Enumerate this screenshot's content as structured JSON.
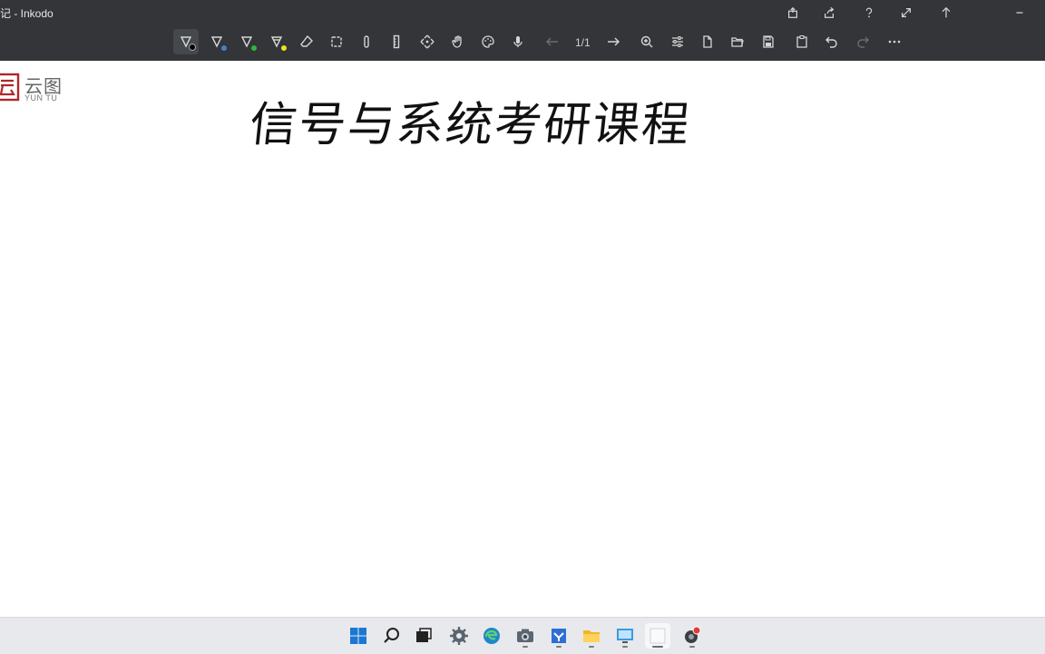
{
  "window": {
    "title": "记 - Inkodo"
  },
  "toolbar": {
    "page_indicator": "1/1",
    "pen_colors": [
      "#000000",
      "#4a7bd6",
      "#2db83d",
      "#e6e61c"
    ]
  },
  "canvas": {
    "logo_cn": "云图",
    "logo_en": "YUN TU",
    "handwritten_title": "信号与系统考研课程"
  },
  "colors": {
    "titlebar": "#333538",
    "taskbar": "#e7e9ec",
    "logo_red": "#b0262a"
  }
}
